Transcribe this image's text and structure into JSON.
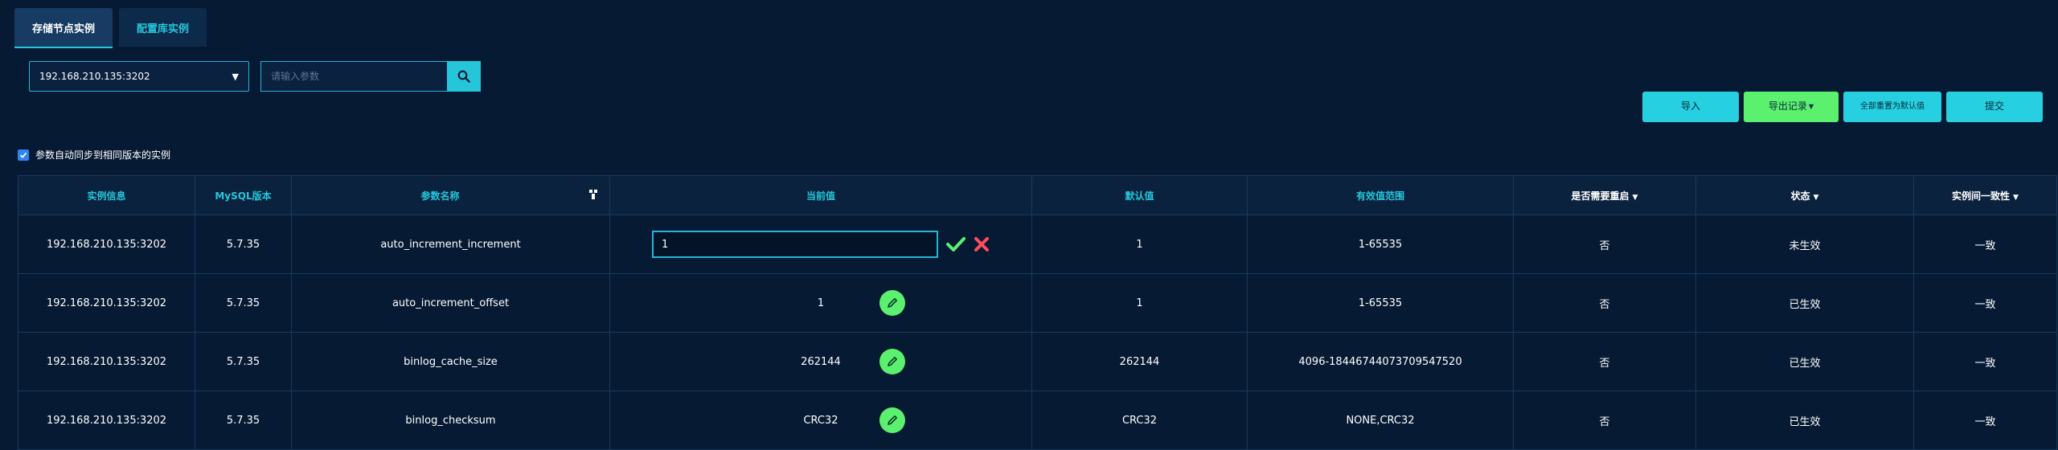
{
  "tabs": [
    {
      "label": "存储节点实例",
      "active": true
    },
    {
      "label": "配置库实例",
      "active": false
    }
  ],
  "instance_select": {
    "value": "192.168.210.135:3202"
  },
  "search": {
    "placeholder": "请输入参数",
    "value": ""
  },
  "actions": {
    "import_label": "导入",
    "export_label": "导出记录",
    "reset_all_label": "全部重置为默认值",
    "submit_label": "提交"
  },
  "sync_checkbox": {
    "label": "参数自动同步到相同版本的实例",
    "checked": true
  },
  "table": {
    "headers": {
      "instance": "实例信息",
      "mysql_version": "MySQL版本",
      "param_name": "参数名称",
      "current_value": "当前值",
      "default_value": "默认值",
      "valid_range": "有效值范围",
      "restart": "是否需要重启",
      "status": "状态",
      "consistency": "实例间一致性"
    },
    "rows": [
      {
        "instance": "192.168.210.135:3202",
        "version": "5.7.35",
        "name": "auto_increment_increment",
        "current": "1",
        "default": "1",
        "range": "1-65535",
        "restart": "否",
        "status": "未生效",
        "consistency": "一致",
        "editing": true
      },
      {
        "instance": "192.168.210.135:3202",
        "version": "5.7.35",
        "name": "auto_increment_offset",
        "current": "1",
        "default": "1",
        "range": "1-65535",
        "restart": "否",
        "status": "已生效",
        "consistency": "一致",
        "editing": false
      },
      {
        "instance": "192.168.210.135:3202",
        "version": "5.7.35",
        "name": "binlog_cache_size",
        "current": "262144",
        "default": "262144",
        "range": "4096-18446744073709547520",
        "restart": "否",
        "status": "已生效",
        "consistency": "一致",
        "editing": false
      },
      {
        "instance": "192.168.210.135:3202",
        "version": "5.7.35",
        "name": "binlog_checksum",
        "current": "CRC32",
        "default": "CRC32",
        "range": "NONE,CRC32",
        "restart": "否",
        "status": "已生效",
        "consistency": "一致",
        "editing": false
      }
    ]
  },
  "colors": {
    "background": "#071a33",
    "accent_cyan": "#26c6da",
    "accent_green": "#5cf06f",
    "status_pending": "#f0a23c",
    "cancel_red": "#ff4d5e"
  },
  "icons": {
    "search": "search-icon",
    "caret": "caret-down-icon",
    "filter": "filter-icon",
    "confirm": "check-icon",
    "cancel": "close-icon",
    "edit": "pencil-icon",
    "checkbox": "checkbox-checked-icon"
  }
}
